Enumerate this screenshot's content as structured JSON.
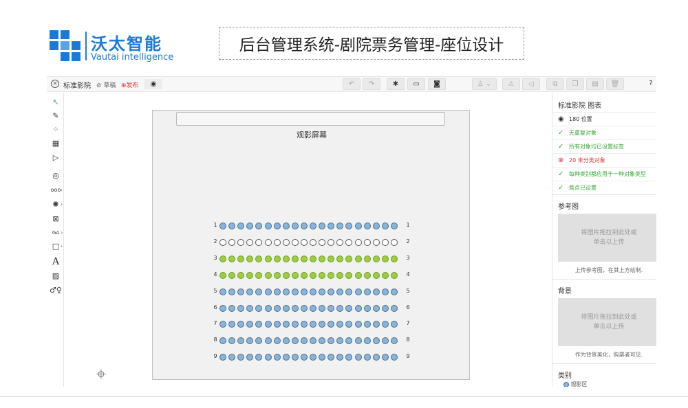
{
  "brand": {
    "name_cn": "沃太智能",
    "name_en": "Vautai intelligence",
    "color": "#1a7ad9"
  },
  "page_title": "后台管理系统-剧院票务管理-座位设计",
  "topbar": {
    "close_icon": "close-circle-icon",
    "map_name": "标准影院",
    "draft_label": "草稿",
    "publish_label": "发布",
    "eye_icon": "eye-icon"
  },
  "canvas": {
    "screen_label": "观影屏幕",
    "rows": [
      {
        "label": "1",
        "style": "blue"
      },
      {
        "label": "2",
        "style": "empty"
      },
      {
        "label": "3",
        "style": "green"
      },
      {
        "label": "4",
        "style": "green"
      },
      {
        "label": "5",
        "style": "blue"
      },
      {
        "label": "6",
        "style": "blue"
      },
      {
        "label": "7",
        "style": "blue"
      },
      {
        "label": "8",
        "style": "blue"
      },
      {
        "label": "9",
        "style": "blue"
      }
    ],
    "seats_per_row": 20,
    "zoom_minus": "−",
    "zoom_plus": "+"
  },
  "right_panel": {
    "header": "标准影院 图表",
    "checks": [
      {
        "icon": "◉",
        "text": "180 位置",
        "status": "info"
      },
      {
        "icon": "✓",
        "text": "无重复对象",
        "status": "ok"
      },
      {
        "icon": "✓",
        "text": "所有对象均已设置标签",
        "status": "ok"
      },
      {
        "icon": "⊗",
        "text": "20 未分类对象",
        "status": "err"
      },
      {
        "icon": "✓",
        "text": "每种类别都应用于一种对象类型",
        "status": "ok"
      },
      {
        "icon": "✓",
        "text": "焦点已设置",
        "status": "ok"
      }
    ],
    "reference_title": "参考图",
    "reference_drop": "将图片拖拉到此处或\n单击以上传",
    "reference_note": "上传参考图，在其上方绘制.",
    "background_title": "背景",
    "background_drop": "将图片拖拉到此处或\n单击以上传",
    "background_note": "作为背景美化，购票者可见.",
    "category_title": "类别",
    "category_item": "观影区"
  }
}
